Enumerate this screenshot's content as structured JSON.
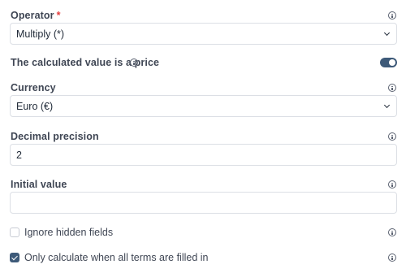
{
  "operator": {
    "label": "Operator",
    "required_mark": "*",
    "value": "Multiply (*)"
  },
  "price_toggle": {
    "label": "The calculated value is a price",
    "enabled": true
  },
  "currency": {
    "label": "Currency",
    "value": "Euro (€)"
  },
  "decimal_precision": {
    "label": "Decimal precision",
    "value": "2"
  },
  "initial_value": {
    "label": "Initial value",
    "value": ""
  },
  "ignore_hidden": {
    "label": "Ignore hidden fields",
    "checked": false
  },
  "only_filled": {
    "label": "Only calculate when all terms are filled in",
    "checked": true
  },
  "colors": {
    "accent": "#3e5a79",
    "required": "#e53e3e",
    "border": "#dcdfe5"
  },
  "icons": [
    "info-icon",
    "chevron-down-icon",
    "check-icon"
  ]
}
